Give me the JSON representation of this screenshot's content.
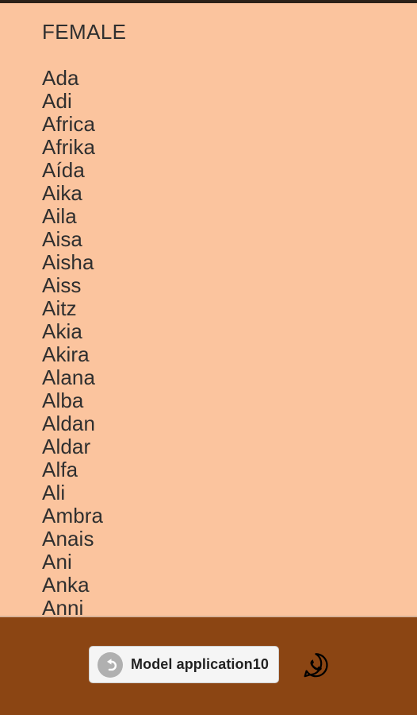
{
  "screen": {
    "background_color": "#fbc49e",
    "bottom_bar_color": "#8b4513",
    "text_color": "#2f2f2f"
  },
  "content": {
    "section_title": "FEMALE",
    "names": [
      "Ada",
      "Adi",
      "Africa",
      "Afrika",
      "Aída",
      "Aika",
      "Aila",
      "Aisa",
      "Aisha",
      "Aiss",
      "Aitz",
      "Akia",
      "Akira",
      "Alana",
      "Alba",
      "Aldan",
      "Aldar",
      "Alfa",
      "Ali",
      "Ambra",
      "Anais",
      "Ani",
      "Anka",
      "Anni"
    ]
  },
  "bottom_bar": {
    "app_chip": {
      "label": "Model application10",
      "icon": "back-arrow-icon",
      "background_color": "#f5f5f5",
      "badge_color": "#b0b0b0"
    },
    "whatsapp": {
      "icon": "whatsapp-icon",
      "color": "#000000"
    }
  }
}
